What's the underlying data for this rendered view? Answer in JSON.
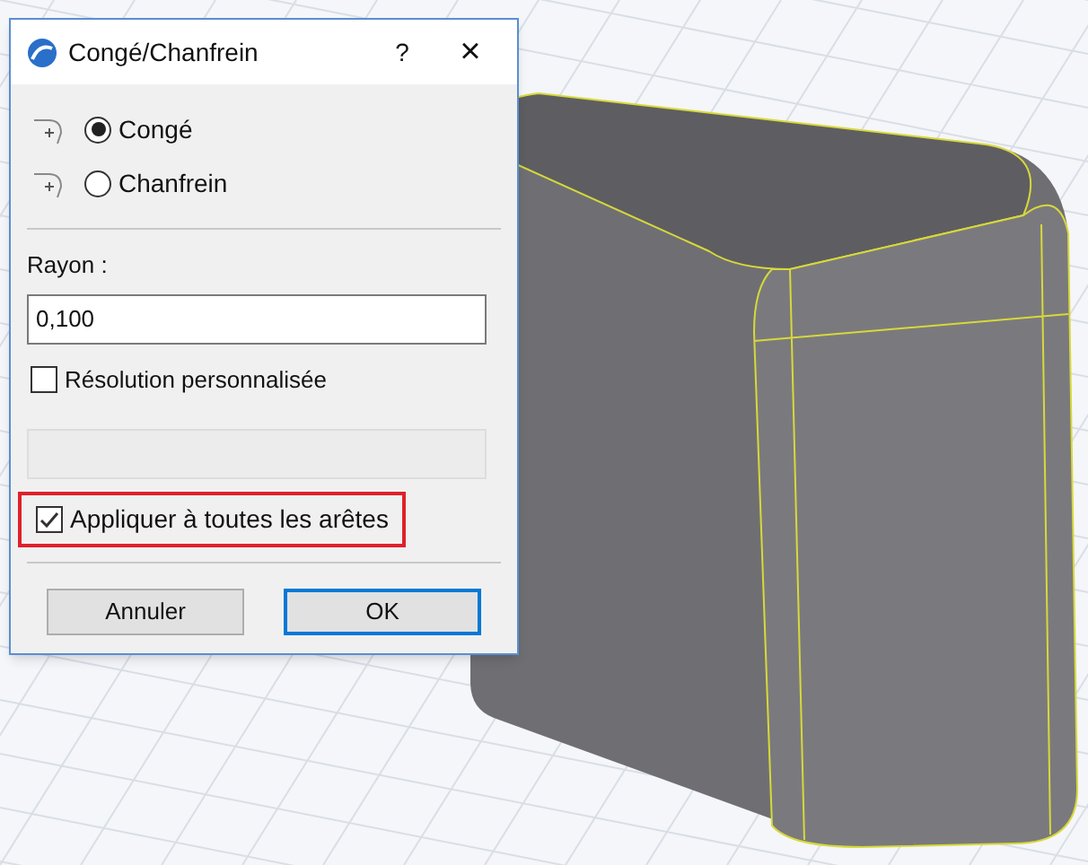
{
  "window": {
    "title": "Congé/Chanfrein",
    "help": "?",
    "close": "×"
  },
  "modes": [
    {
      "label": "Congé",
      "selected": true
    },
    {
      "label": "Chanfrein",
      "selected": false
    }
  ],
  "radius": {
    "label": "Rayon :",
    "value": "0,100"
  },
  "custom_resolution": {
    "label": "Résolution personnalisée",
    "checked": false,
    "field_disabled": true
  },
  "apply_all": {
    "label": "Appliquer à toutes les arêtes",
    "checked": true,
    "highlighted": true
  },
  "buttons": [
    {
      "label": "Annuler",
      "default": false
    },
    {
      "label": "OK",
      "default": true
    }
  ]
}
